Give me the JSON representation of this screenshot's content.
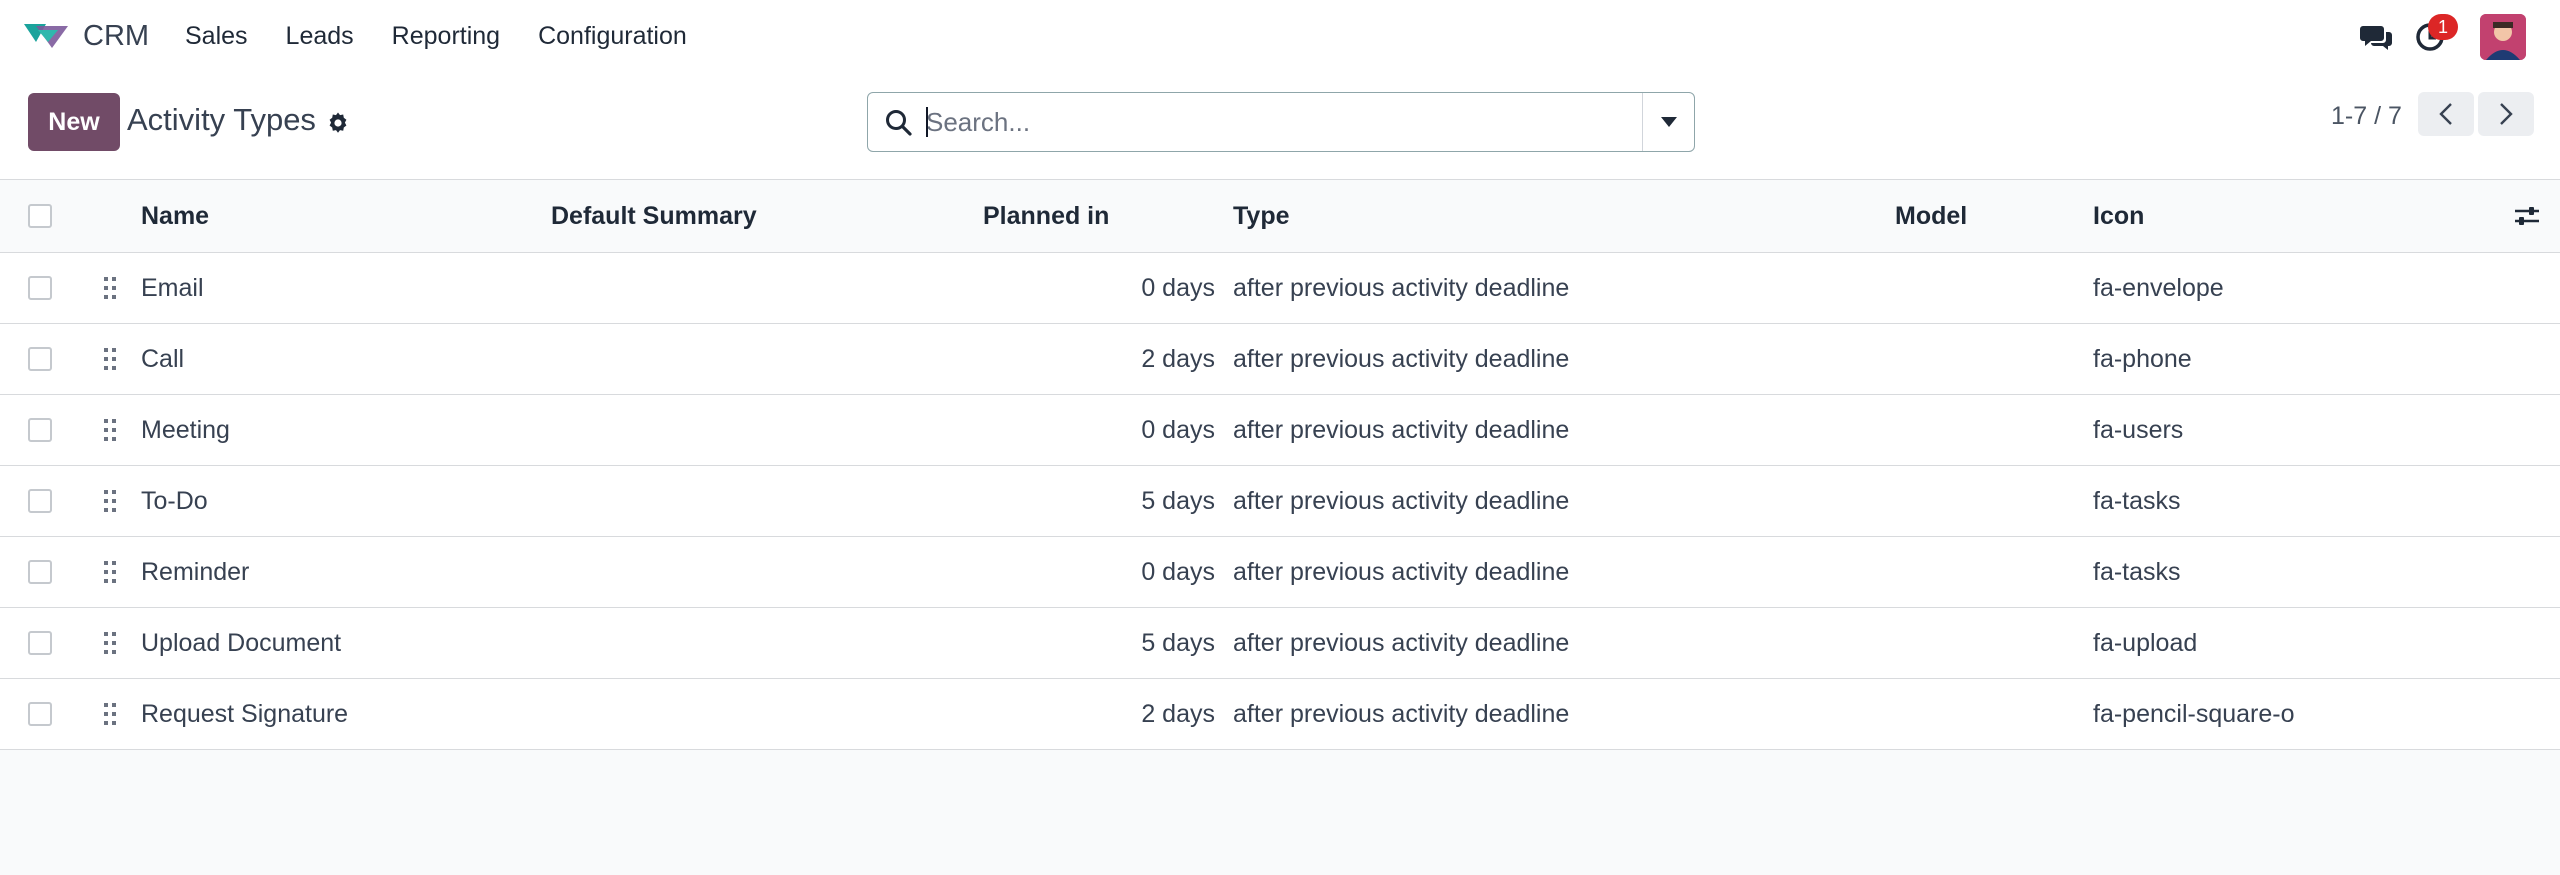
{
  "navbar": {
    "app_name": "CRM",
    "menu": [
      "Sales",
      "Leads",
      "Reporting",
      "Configuration"
    ],
    "activity_badge": "1",
    "brand_colors": {
      "accent": "#714b67",
      "logo_teal": "#1ba39c",
      "logo_purple": "#7c5a9b"
    }
  },
  "control_panel": {
    "new_label": "New",
    "title": "Activity Types",
    "search_placeholder": "Search...",
    "pager": "1-7 / 7"
  },
  "table": {
    "columns": [
      "Name",
      "Default Summary",
      "Planned in",
      "Type",
      "Model",
      "Icon"
    ],
    "rows": [
      {
        "name": "Email",
        "summary": "",
        "planned": "0 days",
        "type": "after previous activity deadline",
        "model": "",
        "icon": "fa-envelope"
      },
      {
        "name": "Call",
        "summary": "",
        "planned": "2 days",
        "type": "after previous activity deadline",
        "model": "",
        "icon": "fa-phone"
      },
      {
        "name": "Meeting",
        "summary": "",
        "planned": "0 days",
        "type": "after previous activity deadline",
        "model": "",
        "icon": "fa-users"
      },
      {
        "name": "To-Do",
        "summary": "",
        "planned": "5 days",
        "type": "after previous activity deadline",
        "model": "",
        "icon": "fa-tasks"
      },
      {
        "name": "Reminder",
        "summary": "",
        "planned": "0 days",
        "type": "after previous activity deadline",
        "model": "",
        "icon": "fa-tasks"
      },
      {
        "name": "Upload Document",
        "summary": "",
        "planned": "5 days",
        "type": "after previous activity deadline",
        "model": "",
        "icon": "fa-upload"
      },
      {
        "name": "Request Signature",
        "summary": "",
        "planned": "2 days",
        "type": "after previous activity deadline",
        "model": "",
        "icon": "fa-pencil-square-o"
      }
    ]
  }
}
